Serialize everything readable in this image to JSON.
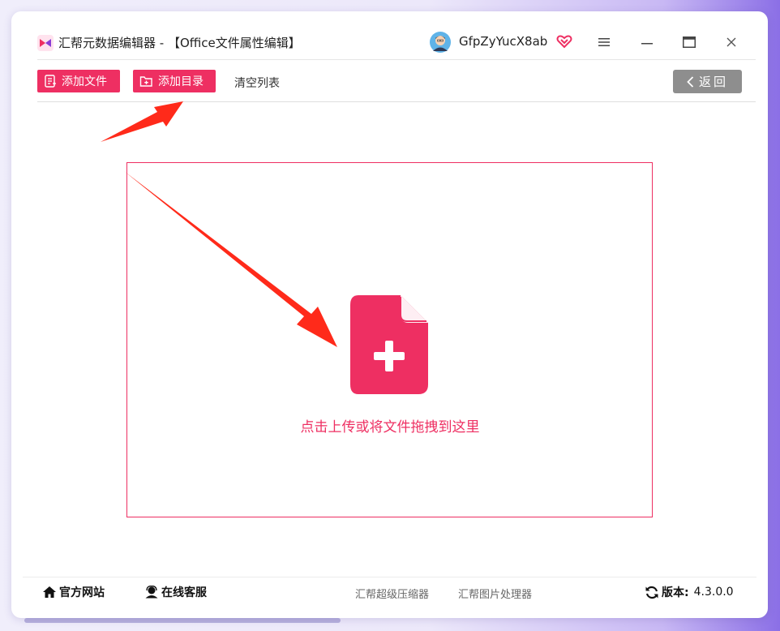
{
  "window": {
    "title": "汇帮元数据编辑器 - 【Office文件属性编辑】"
  },
  "user": {
    "name": "GfpZyYucX8ab"
  },
  "window_controls": {
    "menu": "≡",
    "minimize": "—",
    "maximize": "□",
    "close": "×"
  },
  "toolbar": {
    "add_file_label": "添加文件",
    "add_dir_label": "添加目录",
    "clear_list_label": "清空列表",
    "back_label": "返回"
  },
  "dropzone": {
    "hint": "点击上传或将文件拖拽到这里"
  },
  "footer": {
    "official_site": "官方网站",
    "online_service": "在线客服",
    "compressor": "汇帮超级压缩器",
    "image_tool": "汇帮图片处理器",
    "version_label": "版本:",
    "version_value": "4.3.0.0"
  },
  "colors": {
    "accent": "#ee2f62",
    "back_button": "#8e8e8e",
    "annotation_arrow": "#ff2a1a"
  },
  "icons": {
    "app_logo": "app-logo-icon",
    "avatar": "user-avatar-icon",
    "vip": "vip-heart-icon",
    "add_file": "document-list-icon",
    "add_dir": "folder-add-icon",
    "back": "chevron-left-icon",
    "file_add": "file-add-icon",
    "home": "home-icon",
    "service": "headset-user-icon",
    "refresh": "refresh-icon"
  }
}
